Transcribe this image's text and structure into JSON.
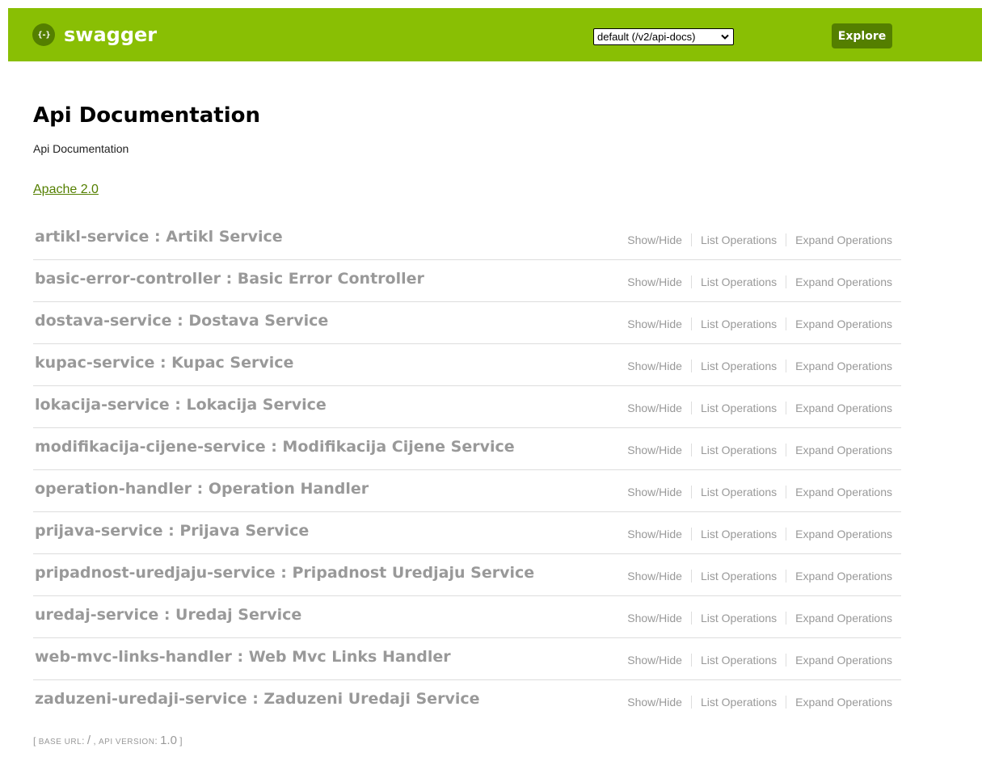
{
  "header": {
    "logo_icon_glyph": "{-}",
    "logo_text": "swagger",
    "spec_select_value": "default (/v2/api-docs)",
    "explore_label": "Explore",
    "colors": {
      "header_bg": "#89bf04",
      "button_bg": "#547f00"
    }
  },
  "info": {
    "title": "Api Documentation",
    "description": "Api Documentation",
    "license": "Apache 2.0"
  },
  "resources": [
    {
      "name": "artikl-service : Artikl Service"
    },
    {
      "name": "basic-error-controller : Basic Error Controller"
    },
    {
      "name": "dostava-service : Dostava Service"
    },
    {
      "name": "kupac-service : Kupac Service"
    },
    {
      "name": "lokacija-service : Lokacija Service"
    },
    {
      "name": "modifikacija-cijene-service : Modifikacija Cijene Service"
    },
    {
      "name": "operation-handler : Operation Handler"
    },
    {
      "name": "prijava-service : Prijava Service"
    },
    {
      "name": "pripadnost-uredjaju-service : Pripadnost Uredjaju Service"
    },
    {
      "name": "uredaj-service : Uredaj Service"
    },
    {
      "name": "web-mvc-links-handler : Web Mvc Links Handler"
    },
    {
      "name": "zaduzeni-uredaji-service : Zaduzeni Uredaji Service"
    }
  ],
  "resource_ops": {
    "show_hide": "Show/Hide",
    "list_operations": "List Operations",
    "expand_operations": "Expand Operations"
  },
  "footer": {
    "open_bracket": "[",
    "base_url_label": "BASE URL",
    "base_url_value": "/",
    "api_version_label": "API VERSION",
    "api_version_value": "1.0",
    "close_bracket": "]"
  }
}
